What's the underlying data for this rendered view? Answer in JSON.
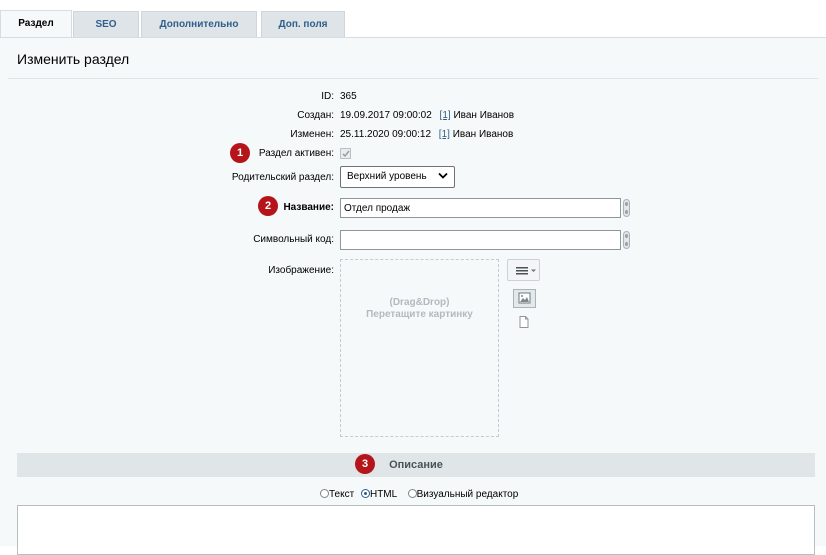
{
  "tabs": [
    {
      "label": "Раздел",
      "active": true
    },
    {
      "label": "SEO",
      "active": false
    },
    {
      "label": "Дополнительно",
      "active": false
    },
    {
      "label": "Доп. поля",
      "active": false
    }
  ],
  "page_title": "Изменить раздел",
  "fields": {
    "id": {
      "label": "ID:",
      "value": "365"
    },
    "created": {
      "label": "Создан:",
      "value": "19.09.2017 09:00:02",
      "user_link": "[1]",
      "user_name": "Иван Иванов"
    },
    "modified": {
      "label": "Изменен:",
      "value": "25.11.2020 09:00:12",
      "user_link": "[1]",
      "user_name": "Иван Иванов"
    },
    "active": {
      "label": "Раздел активен:",
      "checked": true
    },
    "parent": {
      "label": "Родительский раздел:",
      "value": "Верхний уровень"
    },
    "name": {
      "label": "Название:",
      "value": "Отдел продаж"
    },
    "code": {
      "label": "Символьный код:",
      "value": ""
    },
    "image": {
      "label": "Изображение:",
      "drop_line1": "(Drag&Drop)",
      "drop_line2": "Перетащите картинку"
    }
  },
  "badges": [
    "1",
    "2",
    "3"
  ],
  "description_section": {
    "title": "Описание",
    "modes": [
      "Текст",
      "HTML",
      "Визуальный редактор"
    ],
    "selected_mode": "HTML"
  },
  "colors": {
    "badge": "#b5141b",
    "link": "#2f5f8a",
    "panel": "#f5f9f9"
  }
}
